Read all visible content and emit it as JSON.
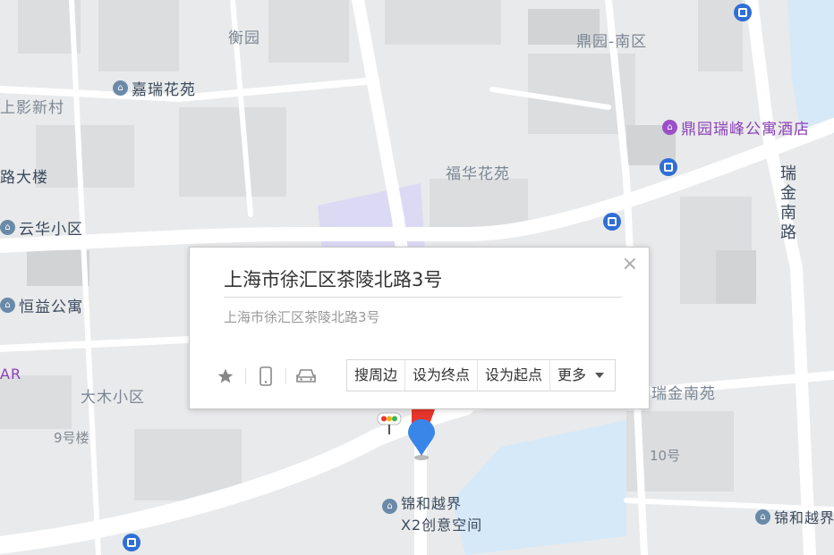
{
  "map": {
    "labels": {
      "hengyuan": "衡园",
      "dingyuan_nanqu": "鼎园-南区",
      "jiarui": "嘉瑞花苑",
      "shangying": "上影新村",
      "dingyuan_ruifeng": "鼎园瑞峰公寓酒店",
      "lu_dalou": "路大楼",
      "fuhua": "福华花苑",
      "yunhua": "云华小区",
      "ruijin_nanlu": "瑞金南路",
      "hengyi": "恒益公寓",
      "ar": "AR",
      "damu": "大木小区",
      "ruijin_nanyuan": "瑞金南苑",
      "no9": "9号楼",
      "no10": "10号",
      "jinhe_x2_line1": "锦和越界",
      "jinhe_x2_line2": "X2创意空间",
      "jinhe_right": "锦和越界"
    },
    "colors": {
      "road": "#ffffff",
      "block": "#e2e3e4",
      "building": "#d7d8da",
      "water": "#d6e9f8",
      "school": "#dcd9f5",
      "bus": "#2f6fd6",
      "marker_red": "#e8352b",
      "marker_blue": "#3a86e8"
    }
  },
  "popup": {
    "title": "上海市徐汇区茶陵北路3号",
    "address": "上海市徐汇区茶陵北路3号",
    "close_glyph": "×",
    "actions": {
      "nearby": "搜周边",
      "set_end": "设为终点",
      "set_start": "设为起点",
      "more": "更多"
    }
  }
}
